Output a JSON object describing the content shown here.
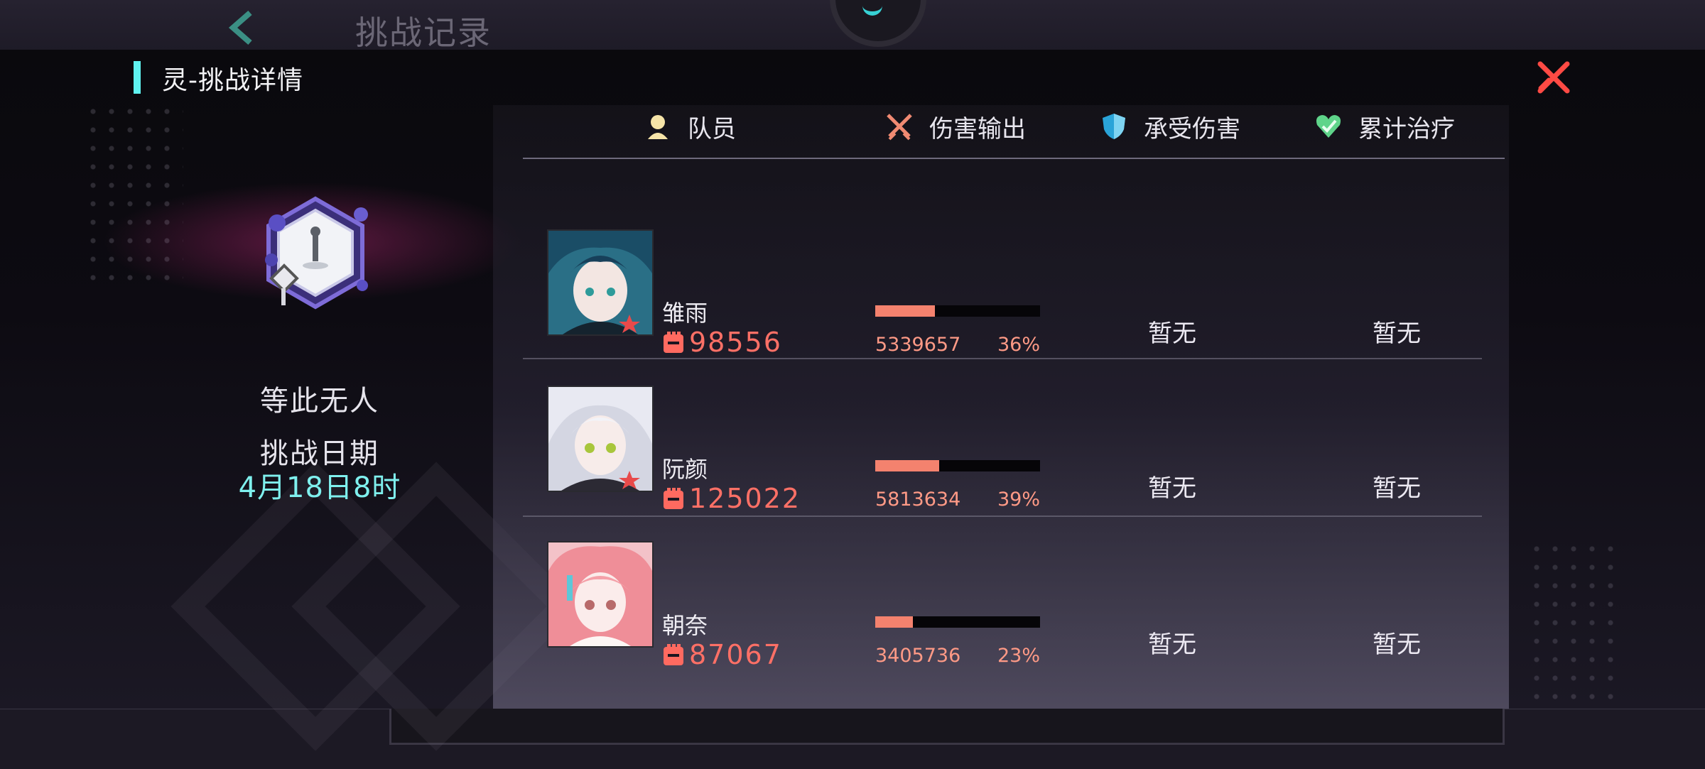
{
  "background": {
    "title": "挑战记录"
  },
  "modal": {
    "title": "灵-挑战详情",
    "boss_name": "等此无人",
    "date_label": "挑战日期",
    "date_value": "4月18日8时"
  },
  "headers": {
    "member": "队员",
    "damage_out": "伤害输出",
    "damage_taken": "承受伤害",
    "healing": "累计治疗"
  },
  "members": [
    {
      "name": "雏雨",
      "power": "98556",
      "damage": "5339657",
      "damage_pct": "36%",
      "damage_ratio": 0.36,
      "taken": "暂无",
      "heal": "暂无"
    },
    {
      "name": "阮颜",
      "power": "125022",
      "damage": "5813634",
      "damage_pct": "39%",
      "damage_ratio": 0.39,
      "taken": "暂无",
      "heal": "暂无"
    },
    {
      "name": "朝奈",
      "power": "87067",
      "damage": "3405736",
      "damage_pct": "23%",
      "damage_ratio": 0.23,
      "taken": "暂无",
      "heal": "暂无"
    }
  ],
  "colors": {
    "accent_cyan": "#5ff2f0",
    "damage_bar": "#f4826e",
    "power_red": "#ff7066",
    "close_red": "#ff4a44"
  }
}
